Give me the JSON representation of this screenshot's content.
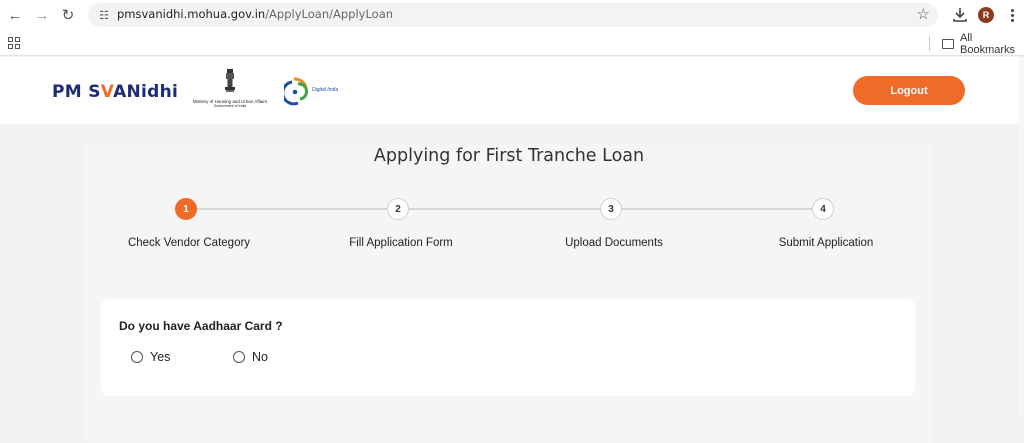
{
  "browser": {
    "url_host": "pmsvanidhi.mohua.gov.in",
    "url_path": "/ApplyLoan/ApplyLoan",
    "profile_initial": "R",
    "all_bookmarks_label": "All Bookmarks"
  },
  "header": {
    "brand_prefix": "PM S",
    "brand_v": "V",
    "brand_suffix": "ANidhi",
    "ministry_line1": "Ministry of Housing and Urban Affairs",
    "ministry_line2": "Government of India",
    "digital_india_label": "Digital India",
    "logout_label": "Logout"
  },
  "page": {
    "title": "Applying for First Tranche Loan",
    "steps": [
      {
        "number": "1",
        "label": "Check Vendor Category",
        "active": true
      },
      {
        "number": "2",
        "label": "Fill Application Form",
        "active": false
      },
      {
        "number": "3",
        "label": "Upload Documents",
        "active": false
      },
      {
        "number": "4",
        "label": "Submit Application",
        "active": false
      }
    ]
  },
  "form": {
    "question": "Do you have Aadhaar Card ?",
    "options": [
      "Yes",
      "No"
    ],
    "selected": null
  },
  "colors": {
    "accent": "#f06a28",
    "brand_blue": "#1e2a78"
  }
}
